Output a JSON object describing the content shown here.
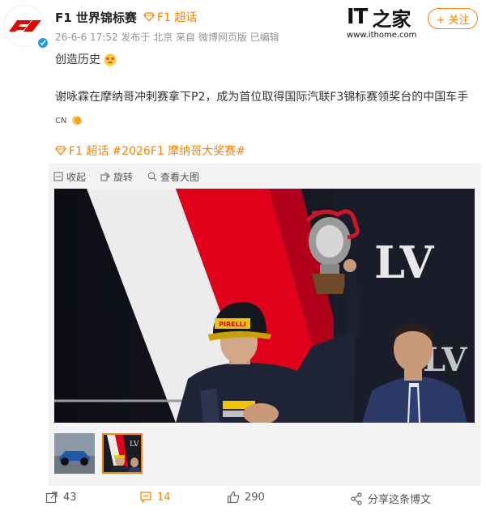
{
  "header": {
    "user_name": "F1 世界锦标赛",
    "topic_tag": "F1 超话",
    "meta": "26-6-6 17:52 发布于 北京 来自 微博网页版 已编辑",
    "follow_label": "+ 关注"
  },
  "watermark": {
    "logo_text_it": "IT",
    "logo_text_zhi": "之家",
    "url": "www.ithome.com"
  },
  "post": {
    "line1": "创造历史",
    "line2": "谢咏霖在摩纳哥冲刺赛拿下P2，成为首位取得国际汽联F3锦标赛领奖台的中国车手",
    "flag_text": "CN",
    "hashtag1": "F1 超话",
    "hashtag2": "#2026F1 摩纳哥大奖赛#"
  },
  "gallery": {
    "collapse_label": "收起",
    "rotate_label": "旋转",
    "view_large_label": "查看大图"
  },
  "photo": {
    "cap_brand": "PIRELLI",
    "suit_brand1": "PIRELLI",
    "suit_brand2": "PERZA",
    "backdrop_text": "LV"
  },
  "actions": {
    "repost_count": "43",
    "comment_count": "14",
    "like_count": "290",
    "share_label": "分享这条博文"
  },
  "colors": {
    "accent": "#ff8200",
    "verified": "#1d9bf0"
  }
}
